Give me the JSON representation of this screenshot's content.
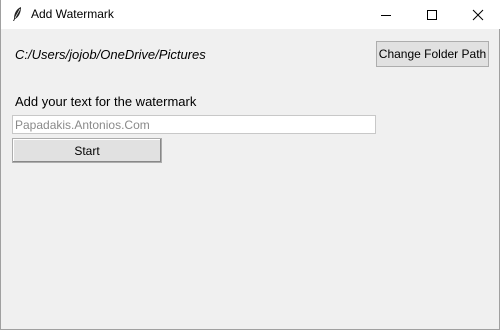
{
  "window": {
    "title": "Add Watermark",
    "controls": {
      "minimize": "minimize-icon",
      "maximize": "maximize-icon",
      "close": "close-icon"
    }
  },
  "main": {
    "folder_path": "C:/Users/jojob/OneDrive/Pictures",
    "change_folder_label": "Change Folder Path",
    "watermark_prompt": "Add your text for the watermark",
    "watermark_input_value": "Papadakis.Antonios.Com",
    "start_label": "Start"
  }
}
